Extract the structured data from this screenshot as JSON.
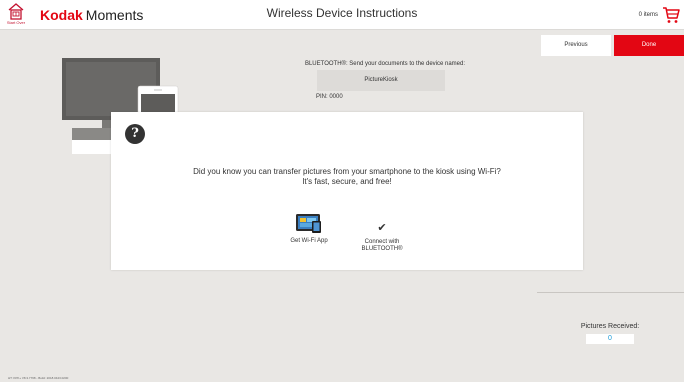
{
  "header": {
    "start_over_label": "Start Over",
    "brand_kodak": "Kodak",
    "brand_moments": "Moments",
    "page_title": "Wireless Device Instructions",
    "cart_count": "0 items"
  },
  "nav": {
    "previous_label": "Previous",
    "done_label": "Done"
  },
  "bluetooth": {
    "instruction": "BLUETOOTH®: Send your documents to the device named:",
    "device_name": "PictureKiosk",
    "pin": "PIN: 0000"
  },
  "modal": {
    "message_line1": "Did you know you can transfer pictures from your smartphone to the kiosk using Wi-Fi?",
    "message_line2": "It's fast, secure, and free!",
    "option_wifi_label": "Get Wi-Fi App",
    "option_bluetooth_line1": "Connect with",
    "option_bluetooth_line2": "BLUETOOTH®"
  },
  "status": {
    "pictures_received_label": "Pictures Received:",
    "pictures_received_value": "0"
  },
  "footer": {
    "version": "HT: KPK+ V8.3.7768 - Build: 2018.0423.0200"
  },
  "colors": {
    "brand_red": "#e30613",
    "accent_blue": "#1a9bd7",
    "background": "#e9e7e4"
  },
  "icons": {
    "start_over": "home-icon",
    "cart": "cart-icon",
    "help": "question-icon",
    "wifi_app": "wifi-app-icon",
    "bluetooth_connect": "checkmark-icon"
  }
}
